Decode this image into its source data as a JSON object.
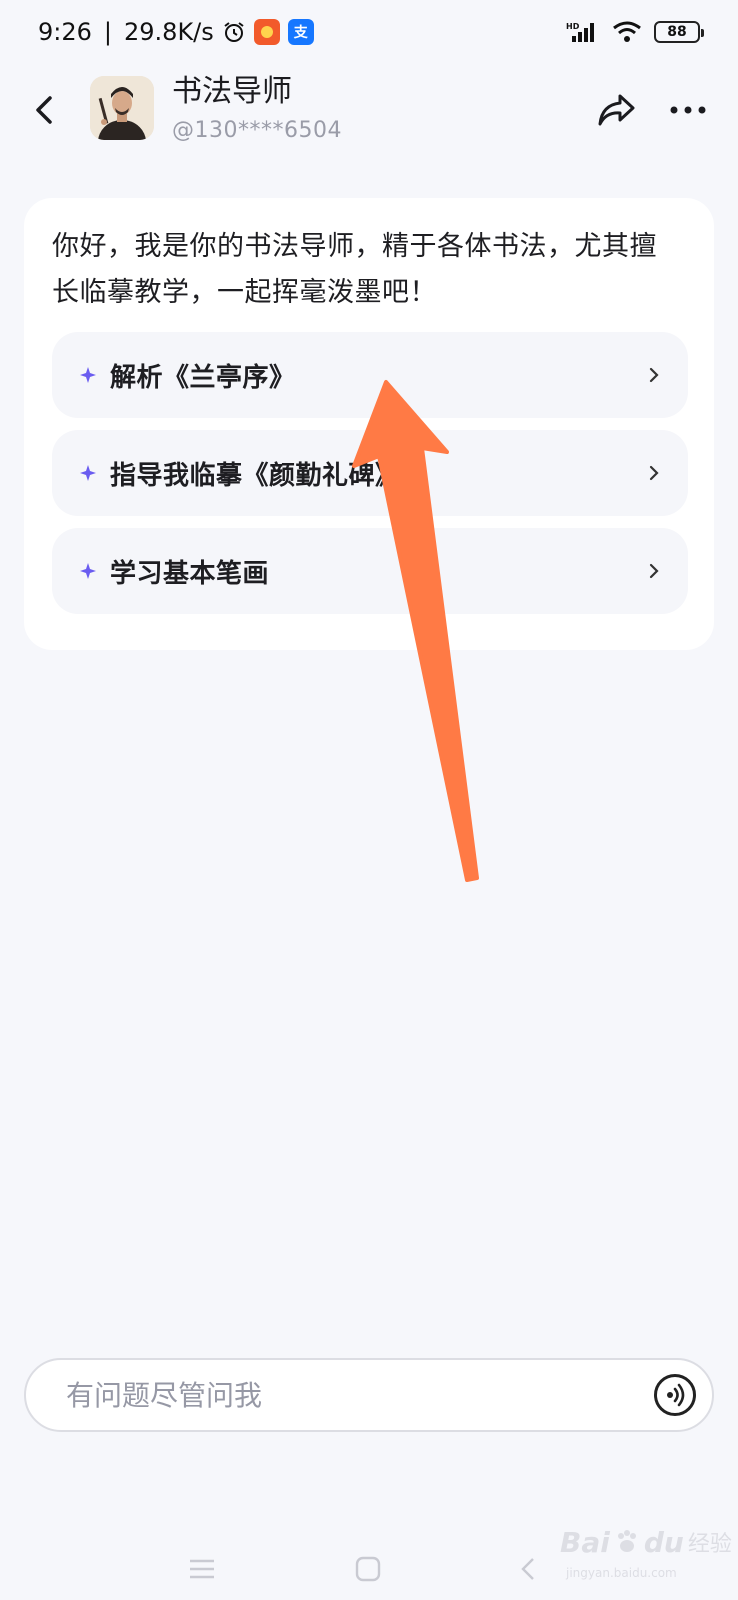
{
  "status_bar": {
    "time": "9:26",
    "network_speed": "29.8K/s",
    "battery": "88",
    "icons": [
      "alarm-icon",
      "app-icon-red",
      "alipay-icon",
      "hd-signal-icon",
      "wifi-icon",
      "battery-icon"
    ],
    "alipay_glyph": "支"
  },
  "header": {
    "title": "书法导师",
    "handle": "@130****6504"
  },
  "greeting": "你好，我是你的书法导师，精于各体书法，尤其擅长临摹教学，一起挥毫泼墨吧！",
  "suggestions": [
    {
      "label": "解析《兰亭序》"
    },
    {
      "label": "指导我临摹《颜勤礼碑》"
    },
    {
      "label": "学习基本笔画"
    }
  ],
  "input": {
    "placeholder": "有问题尽管问我"
  },
  "watermark": {
    "brand": "Bai",
    "brand2": "du",
    "cn": "经验",
    "url": "jingyan.baidu.com"
  },
  "colors": {
    "accent": "#6a5cf0",
    "annotation_arrow": "#ff7a45",
    "background": "#f6f7fb"
  }
}
